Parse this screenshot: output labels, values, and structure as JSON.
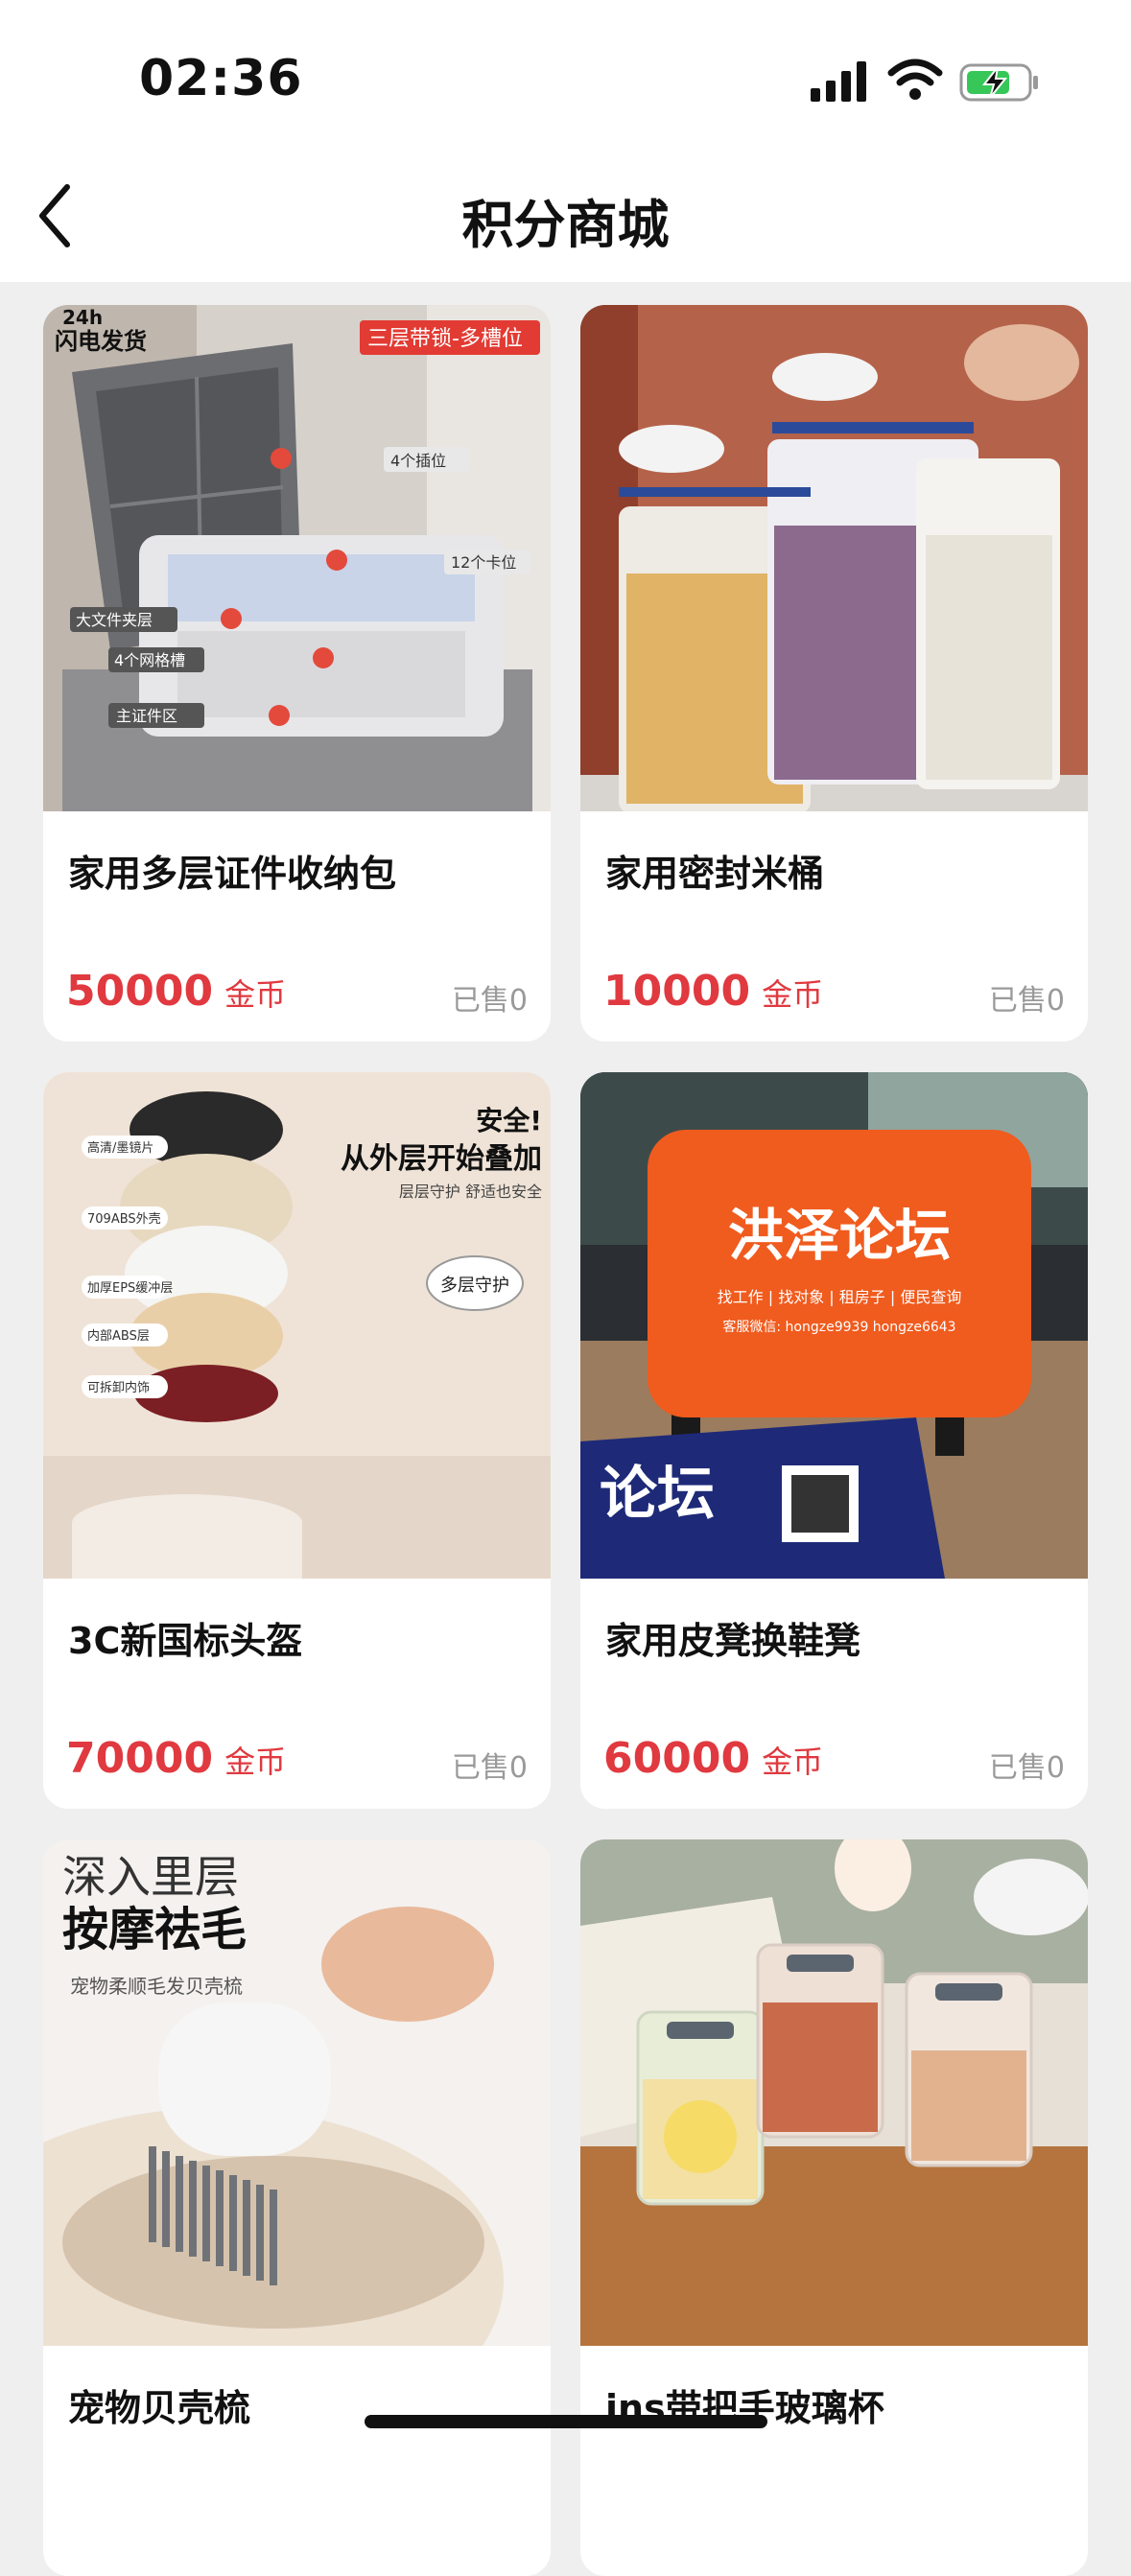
{
  "status_bar": {
    "time": "02:36"
  },
  "header": {
    "title": "积分商城"
  },
  "products": [
    {
      "name": "家用多层证件收纳包",
      "price": "50000",
      "unit": "金币",
      "sold": "已售0",
      "image_text": {
        "badge": "24h",
        "badge2": "闪电发货",
        "tag": "三层带锁-多槽位",
        "l1": "4个插位",
        "l2": "12个卡位",
        "l3": "大文件夹层",
        "l4": "4个网格槽",
        "l5": "主证件区"
      }
    },
    {
      "name": "家用密封米桶",
      "price": "10000",
      "unit": "金币",
      "sold": "已售0"
    },
    {
      "name": "3C新国标头盔",
      "price": "70000",
      "unit": "金币",
      "sold": "已售0",
      "image_text": {
        "h1": "安全!",
        "h2": "从外层开始叠加",
        "h3": "层层守护 舒适也安全",
        "bubble": "多层守护",
        "t1": "高清/墨镜片",
        "t2": "709ABS外壳",
        "t3": "加厚EPS缓冲层",
        "t4": "内部ABS层",
        "t5": "可拆卸内饰"
      }
    },
    {
      "name": "家用皮凳换鞋凳",
      "price": "60000",
      "unit": "金币",
      "sold": "已售0",
      "image_text": {
        "brand": "洪泽论坛",
        "line": "找工作 | 找对象 | 租房子 | 便民查询",
        "contact": "客服微信: hongze9939  hongze6643",
        "poster": "论坛"
      }
    },
    {
      "name": "宠物贝壳梳",
      "price": "",
      "unit": "",
      "sold": "",
      "image_text": {
        "a": "深入里层",
        "b": "按摩祛毛",
        "c": "宠物柔顺毛发贝壳梳"
      }
    },
    {
      "name": "ins带把手玻璃杯",
      "price": "",
      "unit": "",
      "sold": ""
    }
  ],
  "colors": {
    "price": "#e0393f",
    "background": "#efefef"
  }
}
